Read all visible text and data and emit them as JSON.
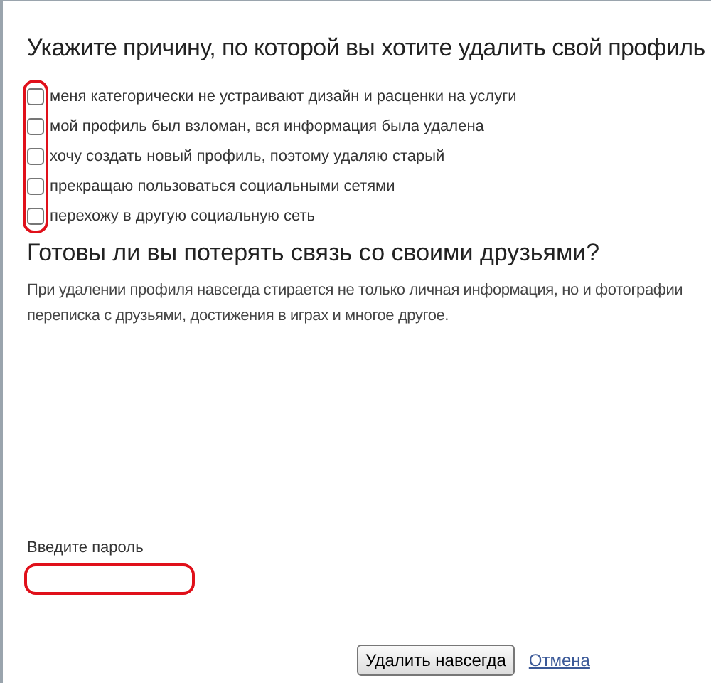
{
  "title": "Укажите причину, по которой вы хотите удалить свой профиль",
  "reasons_highlighted": true,
  "reasons": [
    {
      "label": "меня категорически не устраивают дизайн и расценки на услуги",
      "checked": false
    },
    {
      "label": "мой профиль был взломан, вся информация была удалена",
      "checked": false
    },
    {
      "label": "хочу создать новый профиль, поэтому удаляю старый",
      "checked": false
    },
    {
      "label": "прекращаю пользоваться социальными сетями",
      "checked": false
    },
    {
      "label": "перехожу в другую социальную сеть",
      "checked": false
    }
  ],
  "question": "Готовы ли вы потерять связь со своими друзьями?",
  "warning": "При удалении профиля навсегда стирается не только личная информация, но и фотографии переписка с друзьями, достижения в играх и многое другое.",
  "password": {
    "label": "Введите пароль",
    "highlighted": true
  },
  "delete_button": "Удалить навсегда",
  "cancel_link": "Отмена"
}
